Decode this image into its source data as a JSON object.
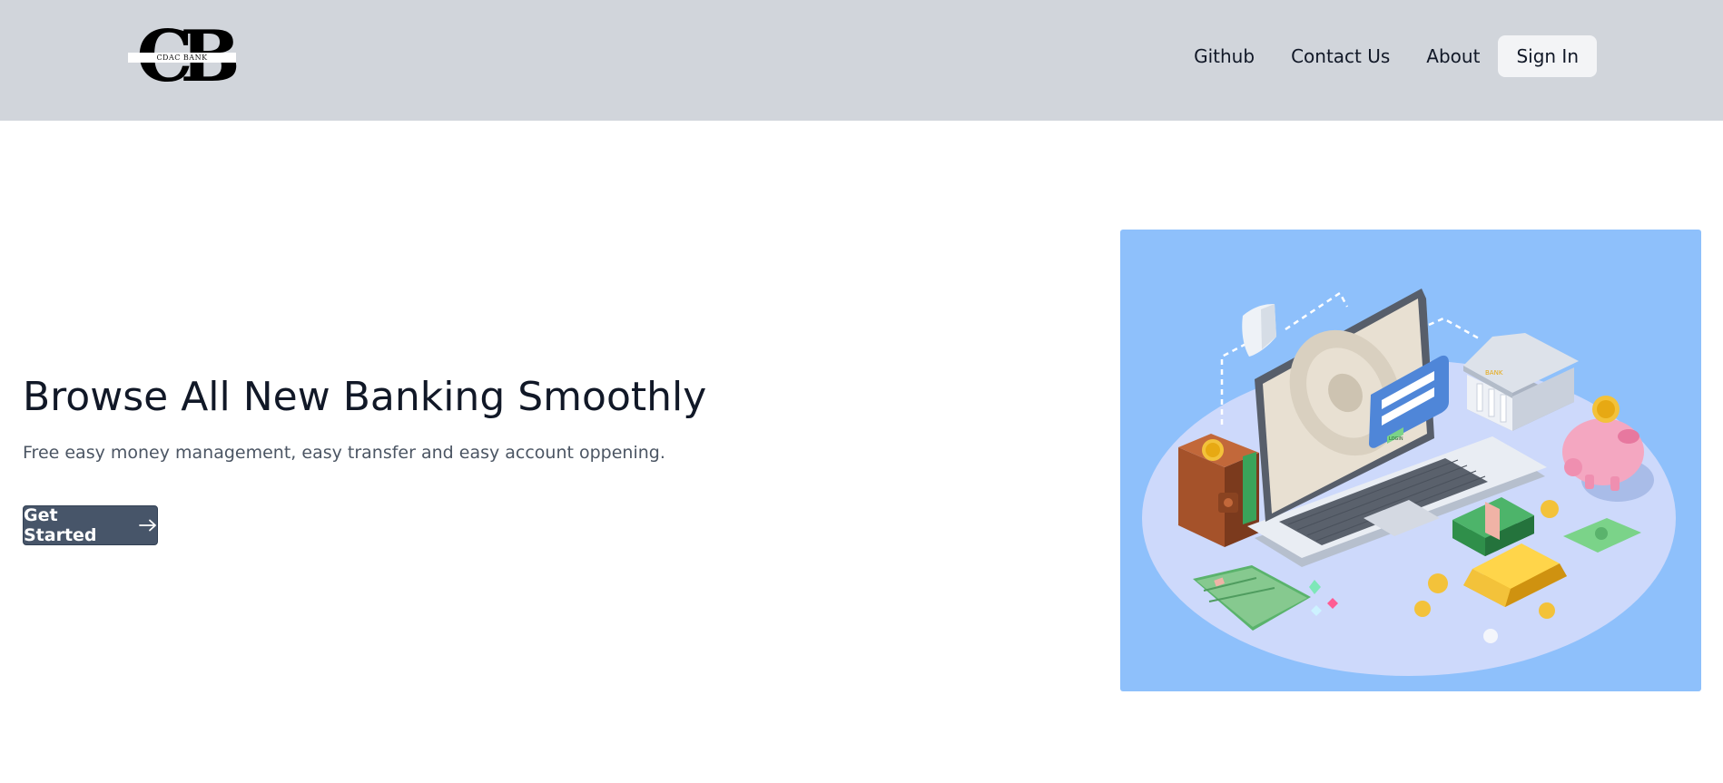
{
  "header": {
    "logo": {
      "monogram": "CB",
      "wordmark": "CDAC BANK"
    },
    "nav": {
      "links": [
        "Github",
        "Contact Us",
        "About"
      ],
      "signin_label": "Sign In"
    }
  },
  "hero": {
    "title": "Browse All New Banking Smoothly",
    "subtitle": "Free easy money management, easy transfer and easy account oppening.",
    "cta_label": "Get Started",
    "cta_icon": "arrow-right-icon"
  },
  "illustration": {
    "icons": [
      "shield-icon",
      "laptop-icon",
      "login-card-icon",
      "bank-building-icon",
      "piggy-bank-icon",
      "wallet-icon",
      "credit-card-icon",
      "cash-stack-icon",
      "gold-bar-icon",
      "coin-icon",
      "banknote-icon",
      "gem-icon"
    ],
    "login_button_text": "LOGIN",
    "bank_sign_text": "BANK"
  },
  "colors": {
    "header_bg": "#d1d5db",
    "cta_bg": "#475569",
    "illustration_bg": "#8ec0fb",
    "title": "#111827",
    "subtitle": "#4b5563"
  }
}
